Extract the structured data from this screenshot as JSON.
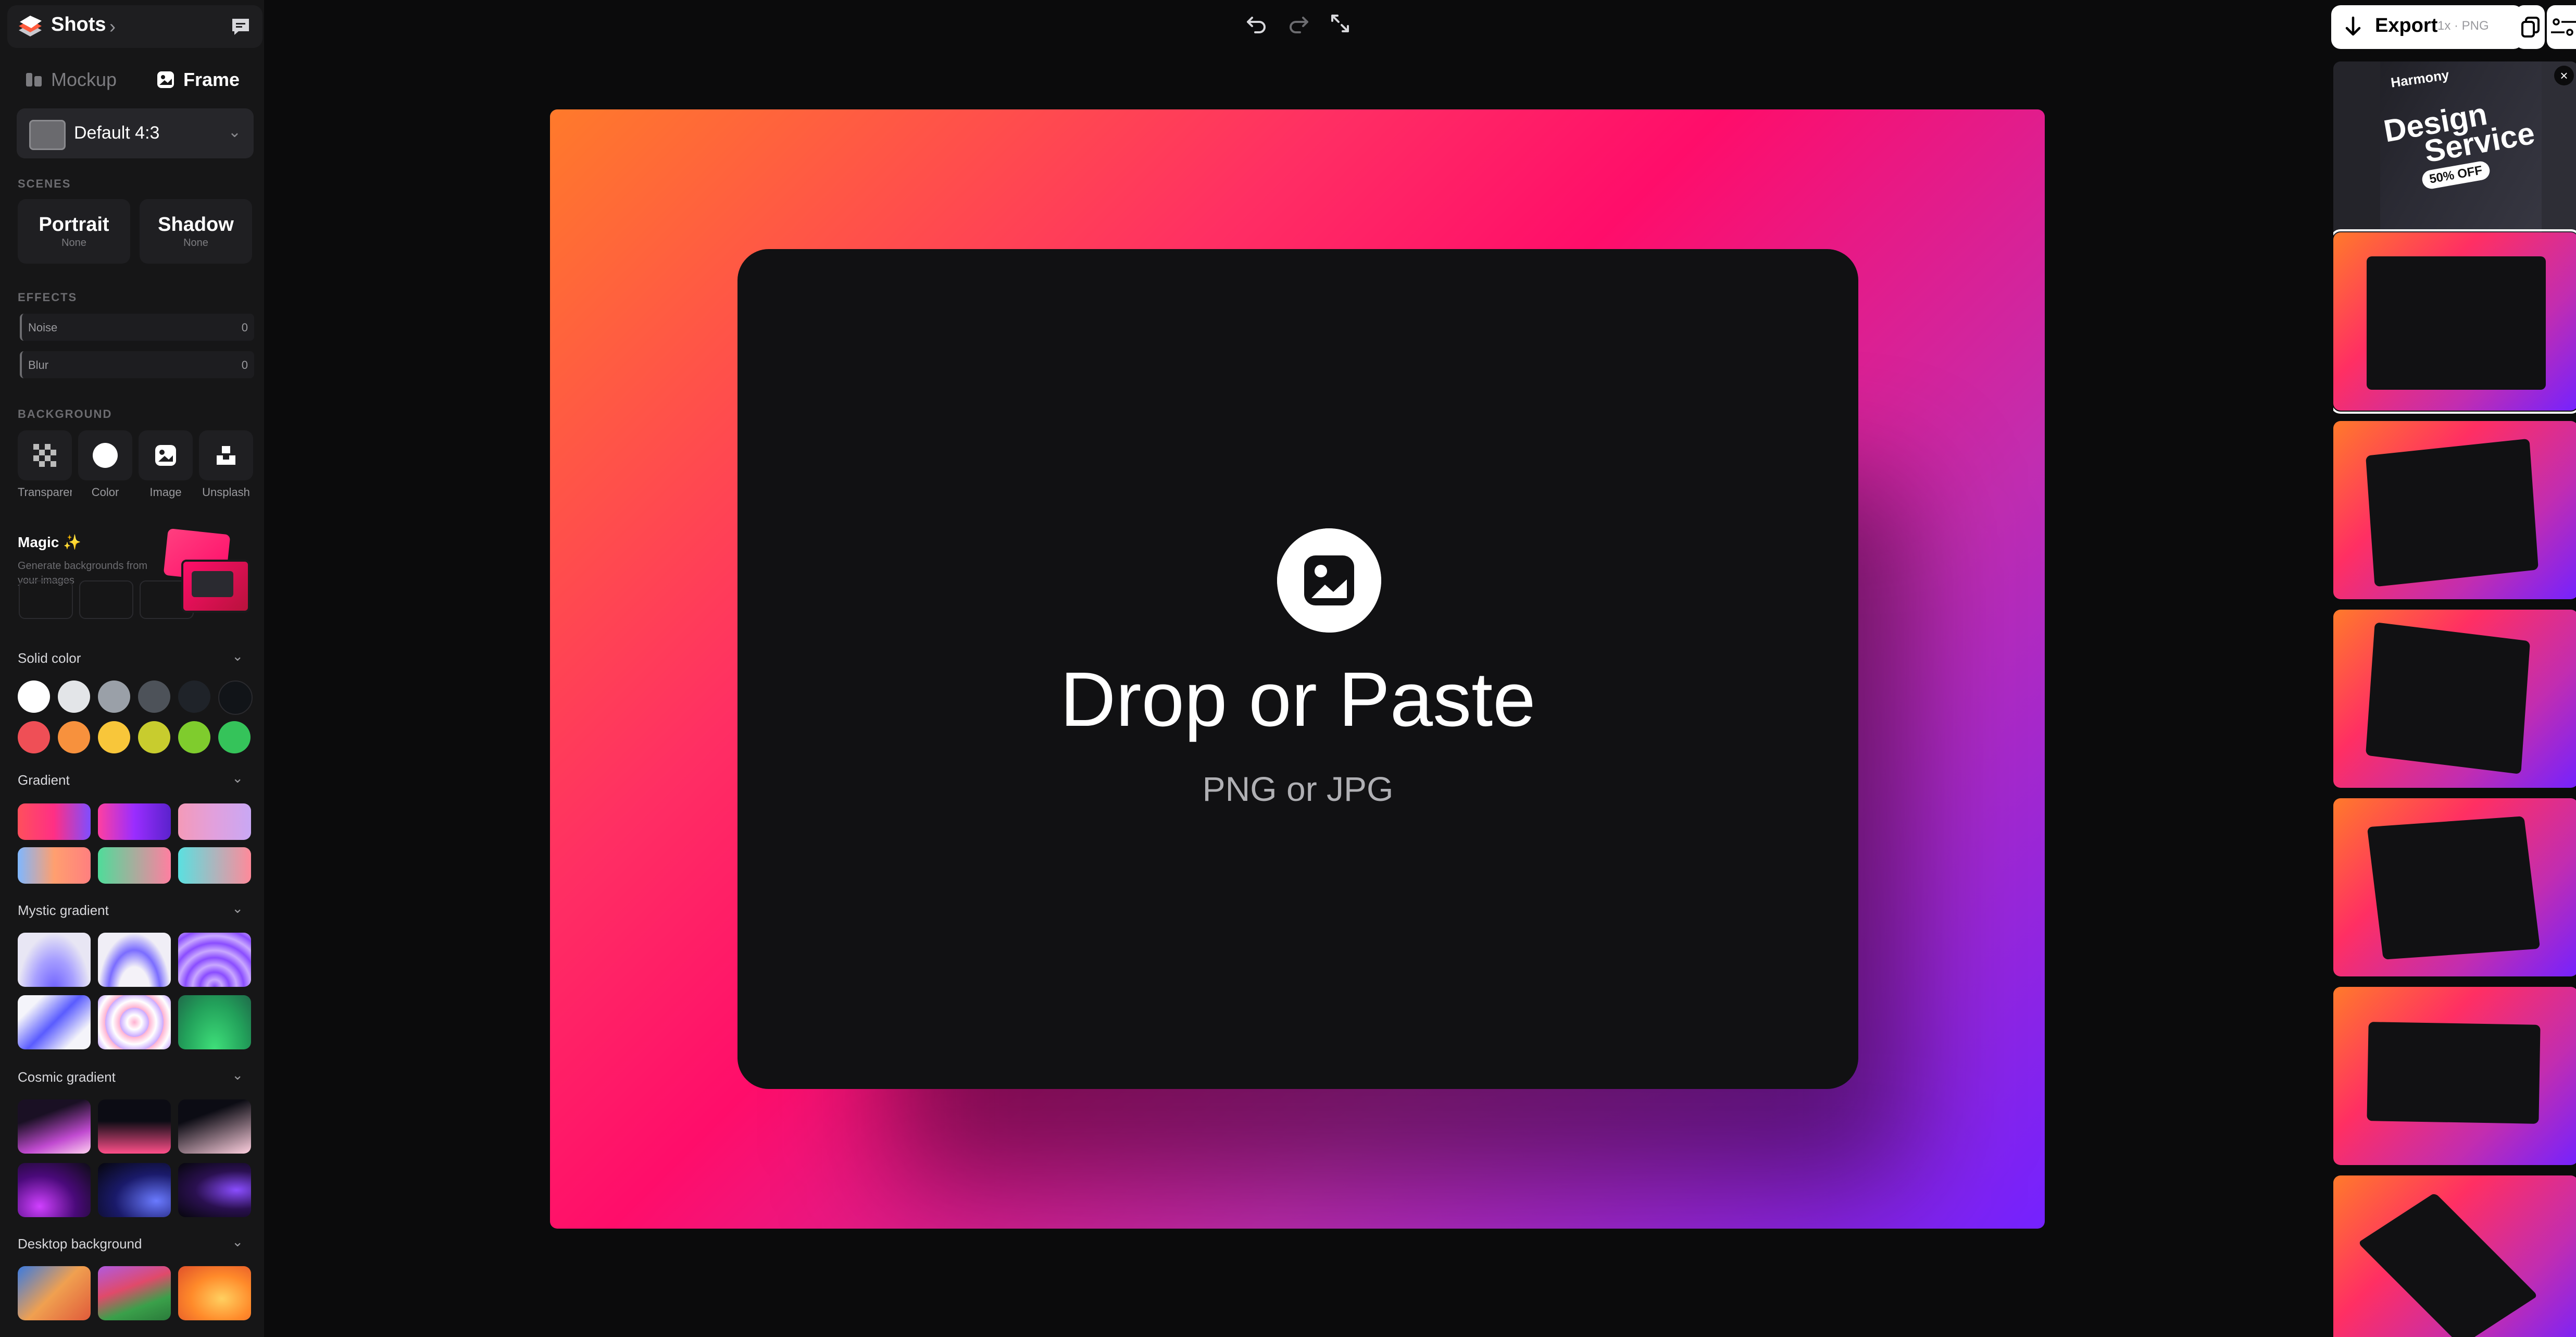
{
  "app": {
    "title": "Shots"
  },
  "mode_tabs": [
    {
      "label": "Mockup"
    },
    {
      "label": "Frame"
    }
  ],
  "preset": {
    "label": "Default 4:3"
  },
  "sections": {
    "scenes": "SCENES",
    "effects": "EFFECTS",
    "background": "BACKGROUND"
  },
  "scenes": [
    {
      "title": "Portrait",
      "value": "None"
    },
    {
      "title": "Shadow",
      "value": "None"
    }
  ],
  "effects": [
    {
      "name": "Noise",
      "value": "0"
    },
    {
      "name": "Blur",
      "value": "0"
    }
  ],
  "background_types": [
    {
      "label": "Transparent",
      "icon": "checkerboard-icon"
    },
    {
      "label": "Color",
      "icon": "circle-icon"
    },
    {
      "label": "Image",
      "icon": "image-icon"
    },
    {
      "label": "Unsplash",
      "icon": "unsplash-icon"
    }
  ],
  "magic": {
    "title": "Magic",
    "description": "Generate backgrounds from your images"
  },
  "categories": {
    "solid": "Solid color",
    "gradient": "Gradient",
    "mystic": "Mystic gradient",
    "cosmic": "Cosmic gradient",
    "desktop": "Desktop background"
  },
  "solid_colors": [
    "#ffffff",
    "#e3e5e8",
    "#9aa0a8",
    "#4d5259",
    "#1f2329",
    "#111418",
    "#ef4f56",
    "#f7913d",
    "#f8c63a",
    "#c8cc2e",
    "#7fcc2d",
    "#35c35a"
  ],
  "drop": {
    "title": "Drop or Paste",
    "subtitle": "PNG or JPG"
  },
  "export": {
    "label": "Export",
    "meta": "1x · PNG"
  },
  "ad": {
    "line1": "Harmony",
    "line2": "Design",
    "line3": "Service",
    "badge": "50% OFF"
  }
}
